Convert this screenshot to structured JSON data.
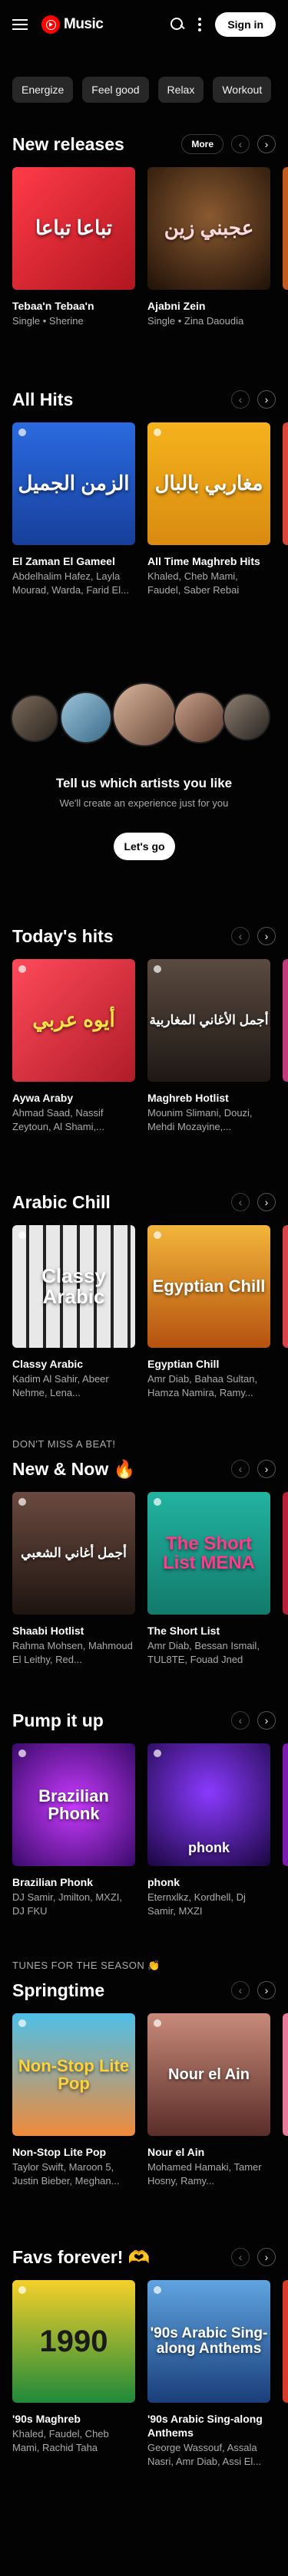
{
  "header": {
    "logo_text": "Music",
    "signin_label": "Sign in"
  },
  "chips": [
    "Energize",
    "Feel good",
    "Relax",
    "Workout"
  ],
  "new_releases": {
    "title": "New releases",
    "more_label": "More",
    "cards": [
      {
        "title": "Tebaa'n Tebaa'n",
        "subtitle": "Single • Sherine",
        "thumb_text": "تباعا تباعا",
        "bg": "#c5202b"
      },
      {
        "title": "Ajabni Zein",
        "subtitle": "Single • Zina Daoudia",
        "thumb_text": "عجبني زين",
        "bg": "#3a2418"
      }
    ]
  },
  "all_hits": {
    "title": "All Hits",
    "cards": [
      {
        "title": "El Zaman El Gameel",
        "subtitle": "Abdelhalim Hafez, Layla Mourad, Warda, Farid El...",
        "thumb_text": "الزمن الجميل",
        "bg": "#1f59c9"
      },
      {
        "title": "All Time Maghreb Hits",
        "subtitle": "Khaled, Cheb Mami, Faudel, Saber Rebai",
        "thumb_text": "مغاربي بالبال",
        "bg": "#e9a018"
      }
    ]
  },
  "artists_prompt": {
    "title": "Tell us which artists you like",
    "subtitle": "We'll create an experience just for you",
    "button_label": "Let's go"
  },
  "todays_hits": {
    "title": "Today's hits",
    "cards": [
      {
        "title": "Aywa Araby",
        "subtitle": "Ahmad Saad, Nassif Zeytoun, Al Shami,...",
        "thumb_text": "أيوه عربي",
        "bg": "#d8303b"
      },
      {
        "title": "Maghreb Hotlist",
        "subtitle": "Mounim Slimani, Douzi, Mehdi Mozayine,...",
        "thumb_text": "أجمل الأغاني المغاربية",
        "bg": "#3b2f28"
      }
    ]
  },
  "arabic_chill": {
    "title": "Arabic Chill",
    "cards": [
      {
        "title": "Classy Arabic",
        "subtitle": "Kadim Al Sahir, Abeer Nehme, Lena...",
        "thumb_text": "Classy Arabic",
        "bg": "#3a3a3a"
      },
      {
        "title": "Egyptian Chill",
        "subtitle": "Amr Diab, Bahaa Sultan, Hamza Namira, Ramy...",
        "thumb_text": "Egyptian Chill",
        "bg": "#e0901a"
      }
    ]
  },
  "new_now": {
    "kicker": "DON'T MISS A BEAT!",
    "title": "New & Now 🔥",
    "cards": [
      {
        "title": "Shaabi Hotlist",
        "subtitle": "Rahma Mohsen, Mahmoud El Leithy, Red...",
        "thumb_text": "أجمل أغاني الشعبي",
        "bg": "#5a3d34"
      },
      {
        "title": "The Short List",
        "subtitle": "Amr Diab, Bessan Ismail, TUL8TE, Fouad Jned",
        "thumb_text": "The Short List MENA",
        "bg": "#1ea591"
      }
    ]
  },
  "pump_it_up": {
    "title": "Pump it up",
    "cards": [
      {
        "title": "Brazilian Phonk",
        "subtitle": "DJ Samir, Jmilton, MXZI, DJ FKU",
        "thumb_text": "Brazilian Phonk",
        "bg": "#6a1fa0"
      },
      {
        "title": "phonk",
        "subtitle": "Eternxlkz, Kordhell, Dj Samir, MXZI",
        "thumb_text": "phonk",
        "bg": "#3d1780"
      }
    ]
  },
  "springtime": {
    "kicker": "TUNES FOR THE SEASON 👏",
    "title": "Springtime",
    "cards": [
      {
        "title": "Non-Stop Lite Pop",
        "subtitle": "Taylor Swift, Maroon 5, Justin Bieber, Meghan...",
        "thumb_text": "Non-Stop Lite Pop",
        "bg": "#2a9ec8"
      },
      {
        "title": "Nour el Ain",
        "subtitle": "Mohamed Hamaki, Tamer Hosny, Ramy...",
        "thumb_text": "Nour el Ain",
        "bg": "#9a5a4d"
      }
    ]
  },
  "favs_forever": {
    "title": "Favs forever! 🫶",
    "cards": [
      {
        "title": "'90s Maghreb",
        "subtitle": "Khaled, Faudel, Cheb Mami, Rachid Taha",
        "thumb_text": "1990",
        "bg": "#e8c21a"
      },
      {
        "title": "'90s Arabic Sing-along Anthems",
        "subtitle": "George Wassouf, Assala Nasri, Amr Diab, Assi El...",
        "thumb_text": "'90s Arabic Sing-along Anthems",
        "bg": "#2b6cb3"
      }
    ]
  }
}
